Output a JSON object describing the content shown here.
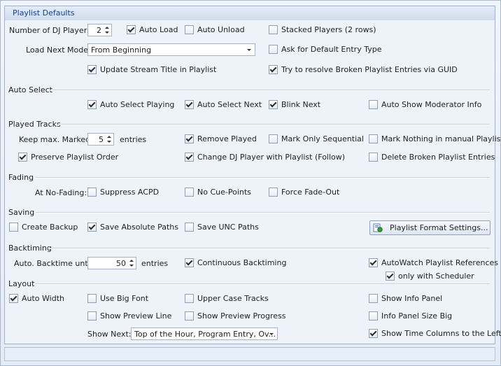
{
  "title": "Playlist Defaults",
  "general": {
    "dj_players_label": "Number of DJ Players:",
    "dj_players_value": "2",
    "auto_load": "Auto Load",
    "auto_unload": "Auto Unload",
    "stacked_players": "Stacked Players (2 rows)",
    "load_next_label": "Load Next Mode:",
    "load_next_value": "From Beginning",
    "ask_default_entry": "Ask for Default Entry Type",
    "update_stream_title": "Update Stream Title in Playlist",
    "resolve_broken": "Try to resolve Broken Playlist Entries via GUID"
  },
  "auto_select": {
    "header": "Auto Select",
    "playing": "Auto Select Playing",
    "next": "Auto Select Next",
    "blink_next": "Blink Next",
    "show_moderator": "Auto Show Moderator Info"
  },
  "played_tracks": {
    "header": "Played Tracks",
    "keep_label": "Keep max. Marked:",
    "keep_value": "5",
    "entries": "entries",
    "remove_played": "Remove Played",
    "mark_only_sequential": "Mark Only Sequential",
    "mark_nothing_manual": "Mark Nothing in manual Playlists",
    "preserve_order": "Preserve Playlist Order",
    "change_dj_player": "Change DJ Player with Playlist (Follow)",
    "delete_broken": "Delete Broken Playlist Entries"
  },
  "fading": {
    "header": "Fading",
    "at_no_fading": "At No-Fading:",
    "suppress_acpd": "Suppress ACPD",
    "no_cue_points": "No Cue-Points",
    "force_fade_out": "Force Fade-Out"
  },
  "saving": {
    "header": "Saving",
    "create_backup": "Create Backup",
    "save_absolute": "Save Absolute Paths",
    "save_unc": "Save UNC Paths",
    "format_settings_button": "Playlist Format Settings..."
  },
  "backtiming": {
    "header": "Backtiming",
    "auto_backtime_label": "Auto. Backtime until:",
    "auto_backtime_value": "50",
    "entries": "entries",
    "continuous": "Continuous Backtiming",
    "autowatch": "AutoWatch Playlist References",
    "only_scheduler": "only with Scheduler"
  },
  "layout": {
    "header": "Layout",
    "auto_width": "Auto Width",
    "big_font": "Use Big Font",
    "upper_case": "Upper Case Tracks",
    "show_info_panel": "Show Info Panel",
    "show_preview_line": "Show Preview Line",
    "show_preview_progress": "Show Preview Progress",
    "info_panel_big": "Info Panel Size Big",
    "show_next_label": "Show Next:",
    "show_next_value": "Top of the Hour, Program Entry, Ov...",
    "time_columns_left": "Show Time Columns to the Left"
  },
  "checked": {
    "auto_load": true,
    "auto_unload": false,
    "stacked_players": false,
    "ask_default_entry": false,
    "update_stream_title": true,
    "resolve_broken": true,
    "as_playing": true,
    "as_next": true,
    "as_blink_next": true,
    "as_show_moderator": false,
    "remove_played": true,
    "mark_only_sequential": false,
    "mark_nothing_manual": false,
    "preserve_order": true,
    "change_dj_player": true,
    "delete_broken": false,
    "suppress_acpd": false,
    "no_cue_points": false,
    "force_fade_out": false,
    "create_backup": false,
    "save_absolute": true,
    "save_unc": false,
    "continuous": true,
    "autowatch": true,
    "only_scheduler": true,
    "auto_width": true,
    "big_font": false,
    "upper_case": false,
    "show_info_panel": false,
    "show_preview_line": false,
    "show_preview_progress": false,
    "info_panel_big": false,
    "time_columns_left": true
  },
  "icons": {
    "format_button_icon": "document-settings-icon"
  },
  "colors": {
    "title_text": "#15428b",
    "panel_bg": "#eef3fa",
    "border": "#9fb2cd"
  }
}
